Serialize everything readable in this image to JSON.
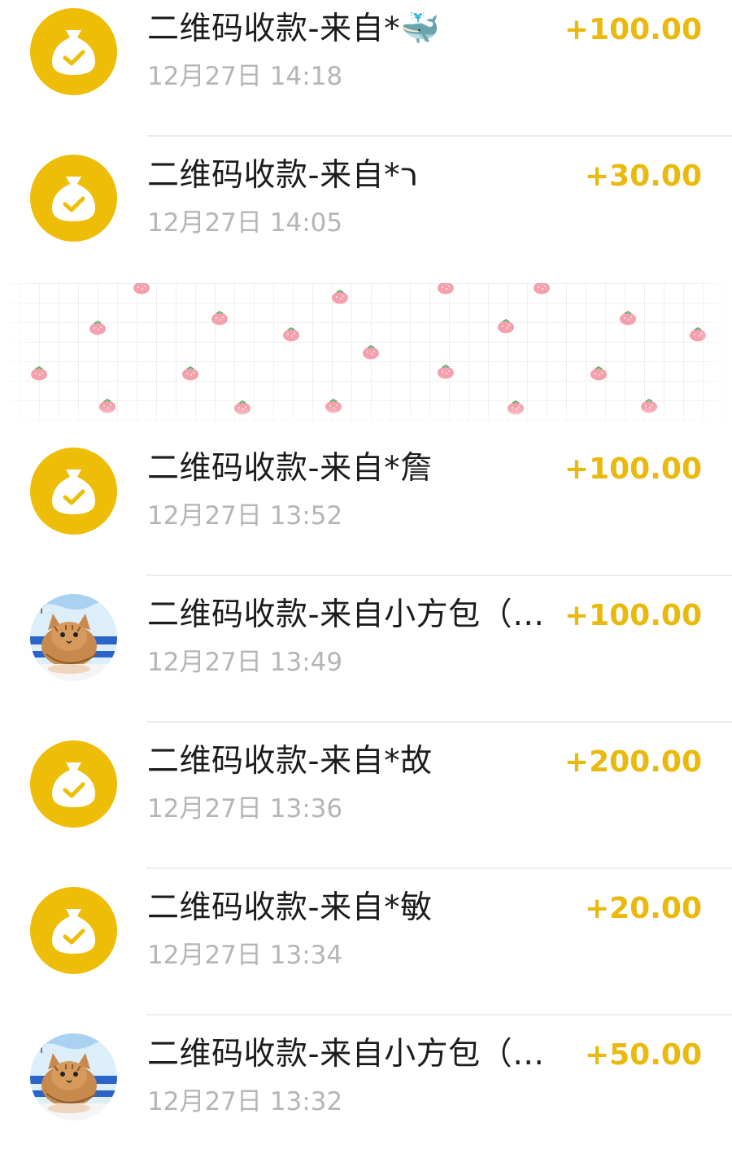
{
  "transactions": [
    {
      "title": "二维码收款-来自*",
      "emoji": "🐳",
      "time": "12月27日 14:18",
      "amount": "+100.00",
      "avatar": "coin-bag-icon"
    },
    {
      "title": "二维码收款-来自*ר",
      "emoji": "",
      "time": "12月27日 14:05",
      "amount": "+30.00",
      "avatar": "coin-bag-icon"
    },
    {
      "title": "二维码收款-来自*詹",
      "emoji": "",
      "time": "12月27日 13:52",
      "amount": "+100.00",
      "avatar": "coin-bag-icon"
    },
    {
      "title": "二维码收款-来自小方包（…",
      "emoji": "",
      "time": "12月27日 13:49",
      "amount": "+100.00",
      "avatar": "cat-avatar"
    },
    {
      "title": "二维码收款-来自*故",
      "emoji": "",
      "time": "12月27日 13:36",
      "amount": "+200.00",
      "avatar": "coin-bag-icon"
    },
    {
      "title": "二维码收款-来自*敏",
      "emoji": "",
      "time": "12月27日 13:34",
      "amount": "+20.00",
      "avatar": "coin-bag-icon"
    },
    {
      "title": "二维码收款-来自小方包（…",
      "emoji": "",
      "time": "12月27日 13:32",
      "amount": "+50.00",
      "avatar": "cat-avatar"
    }
  ],
  "colors": {
    "amount": "#e9b90d",
    "coin_bg": "#eebd07",
    "time": "#b5b5b5",
    "title": "#1c1c1c"
  },
  "banner": {
    "pattern": "strawberry-grid-pattern"
  }
}
